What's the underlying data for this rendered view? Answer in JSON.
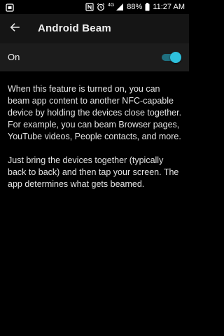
{
  "status_bar": {
    "battery": "88%",
    "time": "11:27 AM",
    "network_type": "4G",
    "icons": [
      "notification-icon",
      "nfc-icon",
      "alarm-icon",
      "signal-icon",
      "battery-icon"
    ]
  },
  "app_bar": {
    "title": "Android Beam",
    "back_icon": "arrow-left-icon"
  },
  "toggle": {
    "label": "On",
    "state": "on",
    "accent_color": "#2ec0dc"
  },
  "description": {
    "paragraph_1": "When this feature is turned on, you can beam app content to another NFC-capable device by holding the devices close together. For example, you can beam Browser pages, YouTube videos, People contacts, and more.",
    "paragraph_2": "Just bring the devices together (typically back to back) and then tap your screen. The app determines what gets beamed."
  }
}
